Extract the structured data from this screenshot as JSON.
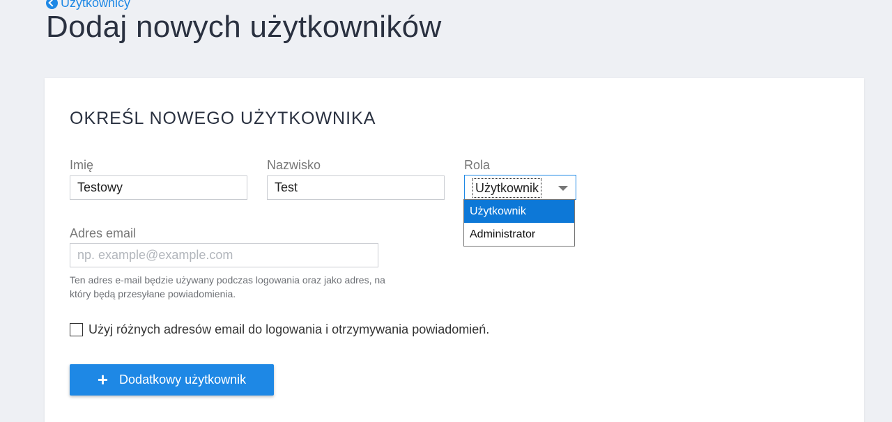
{
  "breadcrumb": {
    "label": "Użytkownicy",
    "icon": "back-arrow-icon"
  },
  "page": {
    "title": "Dodaj nowych użytkowników"
  },
  "form": {
    "title": "OKREŚL NOWEGO UŻYTKOWNIKA",
    "first_name": {
      "label": "Imię",
      "value": "Testowy"
    },
    "last_name": {
      "label": "Nazwisko",
      "value": "Test"
    },
    "role": {
      "label": "Rola",
      "selected": "Użytkownik",
      "options": [
        "Użytkownik",
        "Administrator"
      ]
    },
    "email": {
      "label": "Adres email",
      "value": "",
      "placeholder": "np. example@example.com",
      "help": "Ten adres e-mail będzie używany podczas logowania oraz jako adres, na który będą przesyłane powiadomienia."
    },
    "different_emails": {
      "label": "Użyj różnych adresów email do logowania i otrzymywania powiadomień.",
      "checked": false
    },
    "add_button": {
      "label": "Dodatkowy użytkownik",
      "icon": "plus-icon"
    }
  },
  "colors": {
    "accent": "#1e88e5",
    "dropdown_highlight": "#0d78d7",
    "background": "#eef0f4"
  }
}
